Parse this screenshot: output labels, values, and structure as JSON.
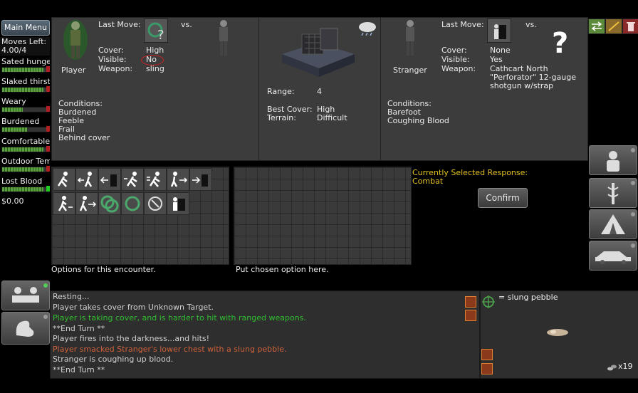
{
  "main_menu": "Main Menu",
  "stats": [
    {
      "label": "Moves Left:",
      "value": "4.00/4"
    },
    {
      "label": "Sated hunge",
      "fill": 0.9
    },
    {
      "label": "Slaked thirst",
      "fill": 0.9
    },
    {
      "label": "Weary",
      "fill": 0.45
    },
    {
      "label": "Burdened",
      "fill": 0.55
    },
    {
      "label": "Comfortable",
      "fill": 0.9
    },
    {
      "label": "Outdoor Tem",
      "fill": 0.9
    },
    {
      "label": "Lost Blood",
      "fill": 0.9
    },
    {
      "label": "$0.00"
    }
  ],
  "player": {
    "last_move": "Last Move:",
    "vs": "vs.",
    "name": "Player",
    "cover_lbl": "Cover:",
    "cover": "High",
    "visible_lbl": "Visible:",
    "visible": "No",
    "weapon_lbl": "Weapon:",
    "weapon": "sling",
    "conditions_lbl": "Conditions:",
    "conditions": [
      "Burdened",
      "Feeble",
      "Frail",
      "Behind cover"
    ]
  },
  "terrain": {
    "range_lbl": "Range:",
    "range": "4",
    "cover_lbl": "Best Cover:",
    "cover": "High",
    "terrain_lbl": "Terrain:",
    "terrain": "Difficult"
  },
  "stranger": {
    "last_move": "Last Move:",
    "vs": "vs.",
    "name": "Stranger",
    "cover_lbl": "Cover:",
    "cover": "None",
    "visible_lbl": "Visible:",
    "visible": "Yes",
    "weapon_lbl": "Weapon:",
    "weapon_lines": [
      "Cathcart North",
      "\"Perforator\" 12-gauge",
      "shotgun w/strap"
    ],
    "conditions_lbl": "Conditions:",
    "conditions": [
      "Barefoot",
      "Coughing Blood"
    ]
  },
  "options_caption": "Options for this encounter.",
  "chosen_caption": "Put chosen option here.",
  "response_title": "Currently Selected Response:",
  "response_value": "Combat",
  "confirm": "Confirm",
  "log": [
    {
      "text": "Resting...",
      "color": "#cfcfcf"
    },
    {
      "text": "Player takes cover from Unknown Target.",
      "color": "#cfcfcf"
    },
    {
      "text": "Player is taking cover, and is harder to hit with ranged weapons.",
      "color": "#2fbf2f"
    },
    {
      "text": "**End Turn **",
      "color": "#cfcfcf"
    },
    {
      "text": "Player fires into the darkness...and hits!",
      "color": "#cfcfcf"
    },
    {
      "text": "Player smacked Stranger's lower chest with a slung pebble.",
      "color": "#d0603a"
    },
    {
      "text": "Stranger is coughing up blood.",
      "color": "#cfcfcf"
    },
    {
      "text": "**End Turn **",
      "color": "#cfcfcf"
    }
  ],
  "ammo_label": "= slung pebble",
  "ammo_count": "x19"
}
